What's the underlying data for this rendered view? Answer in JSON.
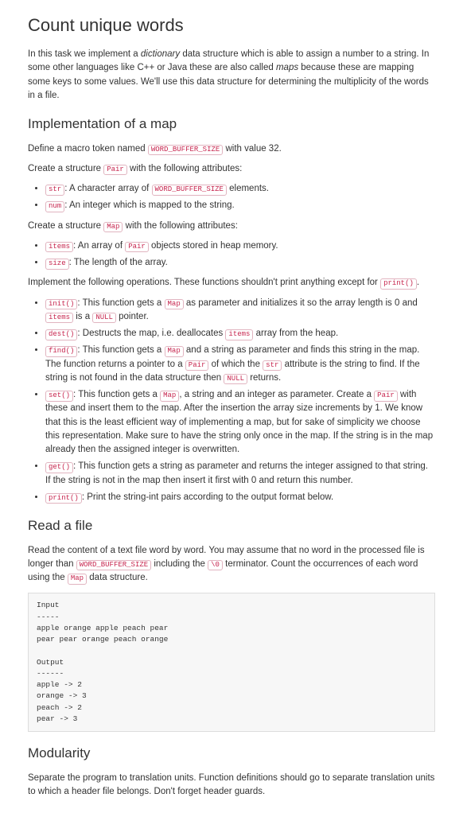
{
  "title": "Count unique words",
  "intro_part1": "In this task we implement a ",
  "intro_em1": "dictionary",
  "intro_part2": " data structure which is able to assign a number to a string. In some other languages like C++ or Java these are also called ",
  "intro_em2": "maps",
  "intro_part3": " because these are mapping some keys to some values. We'll use this data structure for determining the multiplicity of the words in a file.",
  "h2_impl": "Implementation of a map",
  "impl_macro_p1": "Define a macro token named ",
  "impl_macro_code": "WORD_BUFFER_SIZE",
  "impl_macro_p2": " with value 32.",
  "impl_pair_p1": "Create a structure ",
  "impl_pair_code": "Pair",
  "impl_pair_p2": " with the following attributes:",
  "pair_li1_code": "str",
  "pair_li1_t1": ": A character array of ",
  "pair_li1_code2": "WORD_BUFFER_SIZE",
  "pair_li1_t2": " elements.",
  "pair_li2_code": "num",
  "pair_li2_t1": ": An integer which is mapped to the string.",
  "impl_map_p1": "Create a structure ",
  "impl_map_code": "Map",
  "impl_map_p2": " with the following attributes:",
  "map_li1_code": "items",
  "map_li1_t1": ": An array of ",
  "map_li1_code2": "Pair",
  "map_li1_t2": " objects stored in heap memory.",
  "map_li2_code": "size",
  "map_li2_t1": ": The length of the array.",
  "ops_p1": "Implement the following operations. These functions shouldn't print anything except for ",
  "ops_code": "print()",
  "ops_p2": ".",
  "op1_code": "init()",
  "op1_t1": ": This function gets a ",
  "op1_code2": "Map",
  "op1_t2": " as parameter and initializes it so the array length is 0 and ",
  "op1_code3": "items",
  "op1_t3": " is a ",
  "op1_code4": "NULL",
  "op1_t4": " pointer.",
  "op2_code": "dest()",
  "op2_t1": ": Destructs the map, i.e. deallocates ",
  "op2_code2": "items",
  "op2_t2": " array from the heap.",
  "op3_code": "find()",
  "op3_t1": ": This function gets a ",
  "op3_code2": "Map",
  "op3_t2": " and a string as parameter and finds this string in the map. The function returns a pointer to a ",
  "op3_code3": "Pair",
  "op3_t3": " of which the ",
  "op3_code4": "str",
  "op3_t4": " attribute is the string to find. If the string is not found in the data structure then ",
  "op3_code5": "NULL",
  "op3_t5": " returns.",
  "op4_code": "set()",
  "op4_t1": ": This function gets a ",
  "op4_code2": "Map",
  "op4_t2": ", a string and an integer as parameter. Create a ",
  "op4_code3": "Pair",
  "op4_t3": " with these and insert them to the map. After the insertion the array size increments by 1. We know that this is the least efficient way of implementing a map, but for sake of simplicity we choose this representation. Make sure to have the string only once in the map. If the string is in the map already then the assigned integer is overwritten.",
  "op5_code": "get()",
  "op5_t1": ": This function gets a string as parameter and returns the integer assigned to that string. If the string is not in the map then insert it first with 0 and return this number.",
  "op6_code": "print()",
  "op6_t1": ": Print the string-int pairs according to the output format below.",
  "h2_read": "Read a file",
  "read_p1": "Read the content of a text file word by word. You may assume that no word in the processed file is longer than ",
  "read_code1": "WORD_BUFFER_SIZE",
  "read_p2": " including the ",
  "read_code2": "\\0",
  "read_p3": " terminator. Count the occurrences of each word using the ",
  "read_code3": "Map",
  "read_p4": " data structure.",
  "example": "Input\n-----\napple orange apple peach pear\npear pear orange peach orange\n\nOutput\n------\napple -> 2\norange -> 3\npeach -> 2\npear -> 3",
  "h2_mod": "Modularity",
  "mod_p": "Separate the program to translation units. Function definitions should go to separate translation units to which a header file belongs. Don't forget header guards."
}
